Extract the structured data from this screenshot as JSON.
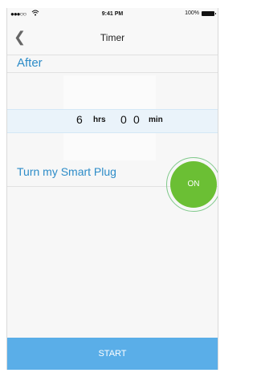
{
  "status_bar": {
    "signal": "●●●○○",
    "wifi": "wifi-icon",
    "time": "9:41 PM",
    "battery": "100%"
  },
  "nav": {
    "back_icon": "chevron-left-icon",
    "title": "Timer"
  },
  "section": {
    "after_label": "After"
  },
  "picker": {
    "hours": "6",
    "hours_unit": "hrs",
    "min_tens": "0",
    "min_ones": "0",
    "min_unit": "min"
  },
  "plug": {
    "label": "Turn my Smart Plug",
    "toggle_label": "ON"
  },
  "actions": {
    "start_label": "START"
  },
  "colors": {
    "accent_blue": "#2d8cc8",
    "toggle_green": "#6bbf34",
    "start_button": "#5aaee8"
  }
}
